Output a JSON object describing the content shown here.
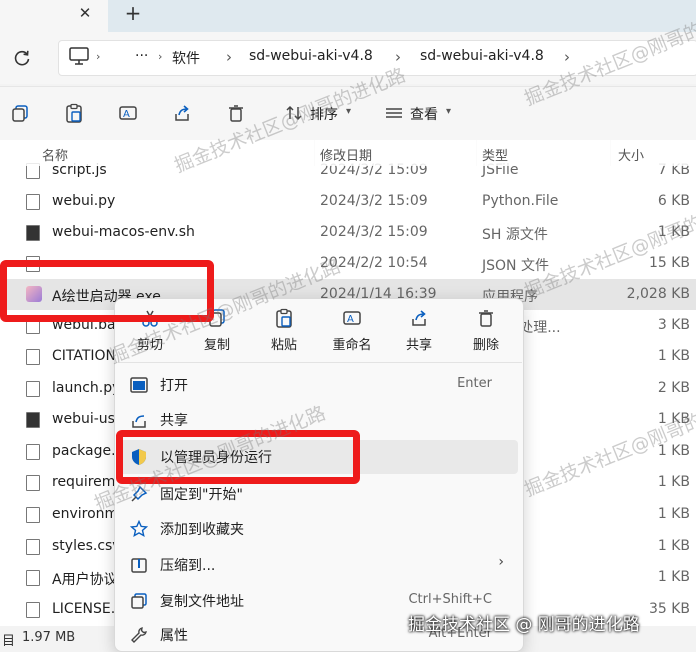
{
  "window": {
    "tab_close_glyph": "✕",
    "tab_new_glyph": "+"
  },
  "address": {
    "more": "···",
    "crumbs": [
      "软件",
      "sd-webui-aki-v4.8",
      "sd-webui-aki-v4.8"
    ]
  },
  "toolbar": {
    "sort_label": "排序",
    "view_label": "查看"
  },
  "columns": {
    "name": "名称",
    "date": "修改日期",
    "type": "类型",
    "size": "大小"
  },
  "files": [
    {
      "name": "script.js",
      "date": "2024/3/2 15:09",
      "type": "JSFile",
      "size": "7 KB"
    },
    {
      "name": "webui.py",
      "date": "2024/3/2 15:09",
      "type": "Python.File",
      "size": "6 KB"
    },
    {
      "name": "webui-macos-env.sh",
      "date": "2024/3/2 15:09",
      "type": "SH 源文件",
      "size": "1 KB"
    },
    {
      "name": "",
      "date": "2024/2/2 10:54",
      "type": "JSON 文件",
      "size": "15 KB"
    },
    {
      "name": "A绘世启动器.exe",
      "date": "2024/1/14 16:39",
      "type": "应用程序",
      "size": "2,028 KB"
    },
    {
      "name": "webui.bat",
      "date": "",
      "type": "ws 批处理...",
      "size": "3 KB"
    },
    {
      "name": "CITATION",
      "date": "",
      "type": "",
      "size": "1 KB"
    },
    {
      "name": "launch.py",
      "date": "",
      "type": ".File",
      "size": "2 KB"
    },
    {
      "name": "webui-use",
      "date": "",
      "type": "文件",
      "size": "1 KB"
    },
    {
      "name": "package.",
      "date": "",
      "type": "文件",
      "size": "1 KB"
    },
    {
      "name": "requirem",
      "date": "",
      "type": "文件",
      "size": "1 KB"
    },
    {
      "name": "environm",
      "date": "",
      "type": "源文件",
      "size": "1 KB"
    },
    {
      "name": "styles.csv",
      "date": "",
      "type": "CSV",
      "size": "1 KB"
    },
    {
      "name": "A用户协议",
      "date": "",
      "type": "档",
      "size": "1 KB"
    },
    {
      "name": "LICENSE.t",
      "date": "",
      "type": "档",
      "size": "35 KB"
    }
  ],
  "status": {
    "selection_size": "1.97 MB"
  },
  "context_menu": {
    "quick_actions": [
      "剪切",
      "复制",
      "粘贴",
      "重命名",
      "共享",
      "删除"
    ],
    "items": [
      {
        "label": "打开",
        "key": "Enter"
      },
      {
        "label": "共享",
        "key": ""
      },
      {
        "label": "以管理员身份运行",
        "key": ""
      },
      {
        "label": "固定到\"开始\"",
        "key": ""
      },
      {
        "label": "添加到收藏夹",
        "key": ""
      },
      {
        "label": "压缩到...",
        "key": ""
      },
      {
        "label": "复制文件地址",
        "key": "Ctrl+Shift+C"
      },
      {
        "label": "属性",
        "key": "Alt+Enter"
      }
    ],
    "submenu_arrow": "›"
  },
  "watermarks": {
    "repeat_text": "掘金技术社区@刚哥的进化路",
    "bottom_text": "掘金技术社区 @ 刚哥的进化路"
  },
  "colors": {
    "annotation_red": "#ee1b1b",
    "accent_blue": "#0a5fbf"
  }
}
